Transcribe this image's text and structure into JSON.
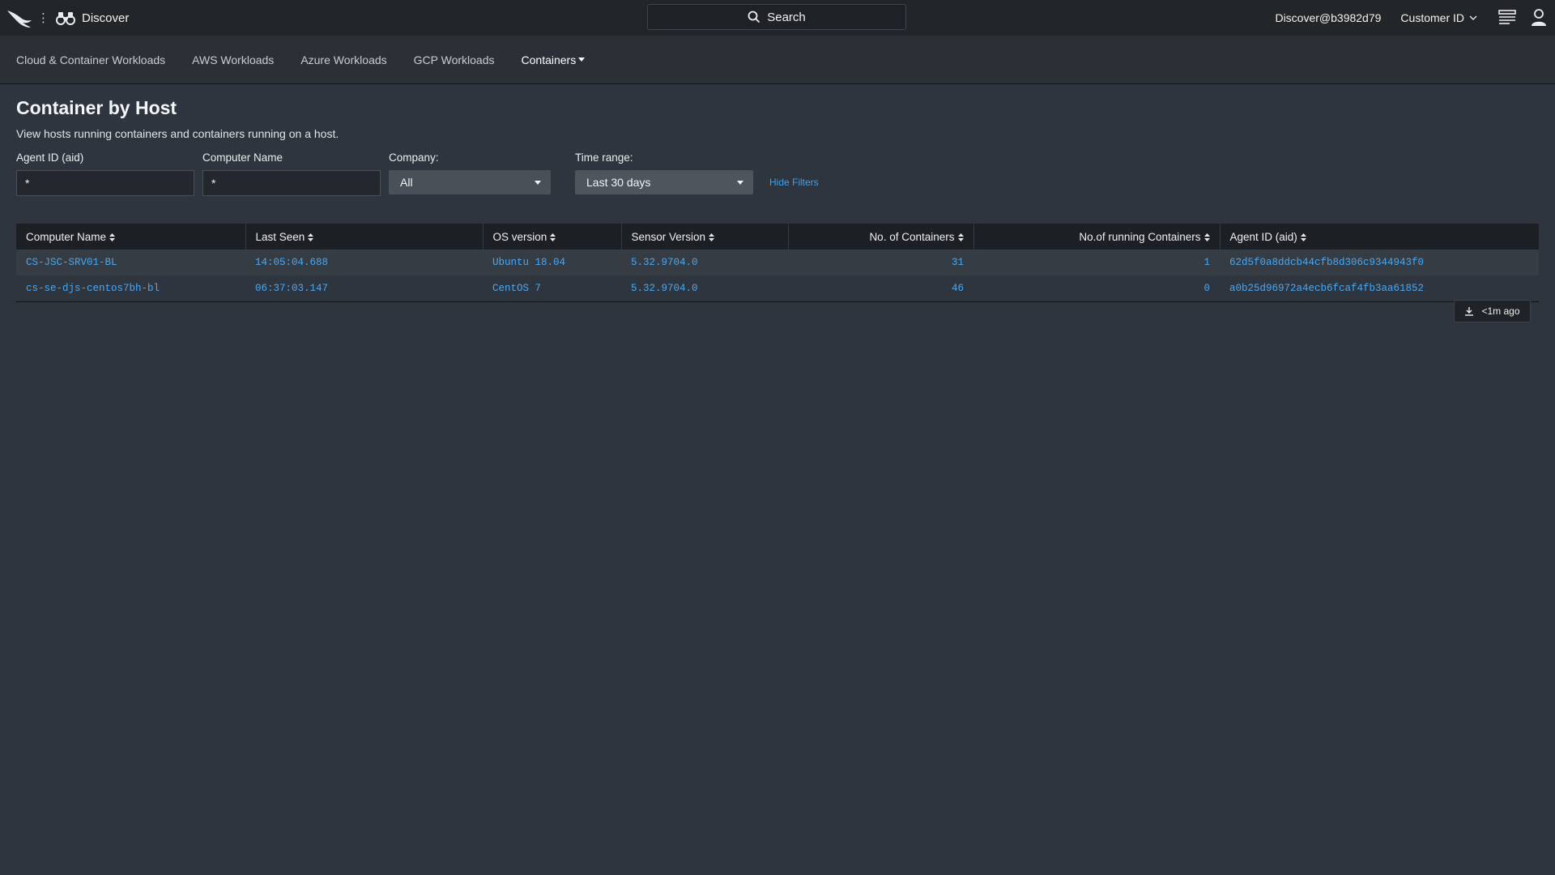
{
  "header": {
    "app_name": "Discover",
    "search_label": "Search",
    "user": "Discover@b3982d79",
    "customer_id_label": "Customer ID",
    "icons": [
      "falcon-logo-icon",
      "more-vertical-icon",
      "binoculars-icon",
      "search-icon",
      "chevron-down-icon",
      "notifications-icon",
      "user-icon"
    ]
  },
  "subnav": {
    "tabs": [
      {
        "label": "Cloud & Container Workloads"
      },
      {
        "label": "AWS Workloads"
      },
      {
        "label": "Azure Workloads"
      },
      {
        "label": "GCP Workloads"
      },
      {
        "label": "Containers"
      }
    ]
  },
  "page": {
    "title": "Container by Host",
    "description": "View hosts running containers and containers running on a host."
  },
  "filters": {
    "agent_id": {
      "label": "Agent ID (aid)",
      "value": "*"
    },
    "computer_name": {
      "label": "Computer Name",
      "value": "*"
    },
    "company": {
      "label": "Company:",
      "value": "All"
    },
    "time_range": {
      "label": "Time range:",
      "value": "Last 30 days"
    },
    "hide_filters": "Hide Filters"
  },
  "table": {
    "columns": [
      "Computer Name",
      "Last Seen",
      "OS version",
      "Sensor Version",
      "No. of Containers",
      "No.of running Containers",
      "Agent ID (aid)"
    ],
    "rows": [
      {
        "computer_name": "CS-JSC-SRV01-BL",
        "last_seen": "14:05:04.688",
        "os_version": "Ubuntu 18.04",
        "sensor_version": "5.32.9704.0",
        "containers": "31",
        "running": "1",
        "agent_id": "62d5f0a8ddcb44cfb8d306c9344943f0"
      },
      {
        "computer_name": "cs-se-djs-centos7bh-bl",
        "last_seen": "06:37:03.147",
        "os_version": "CentOS 7",
        "sensor_version": "5.32.9704.0",
        "containers": "46",
        "running": "0",
        "agent_id": "a0b25d96972a4ecb6fcaf4fb3aa61852"
      }
    ]
  },
  "export": {
    "updated": "<1m ago"
  },
  "colors": {
    "link": "#4aa8f2",
    "background": "#2f353e",
    "topbar": "#232629"
  }
}
